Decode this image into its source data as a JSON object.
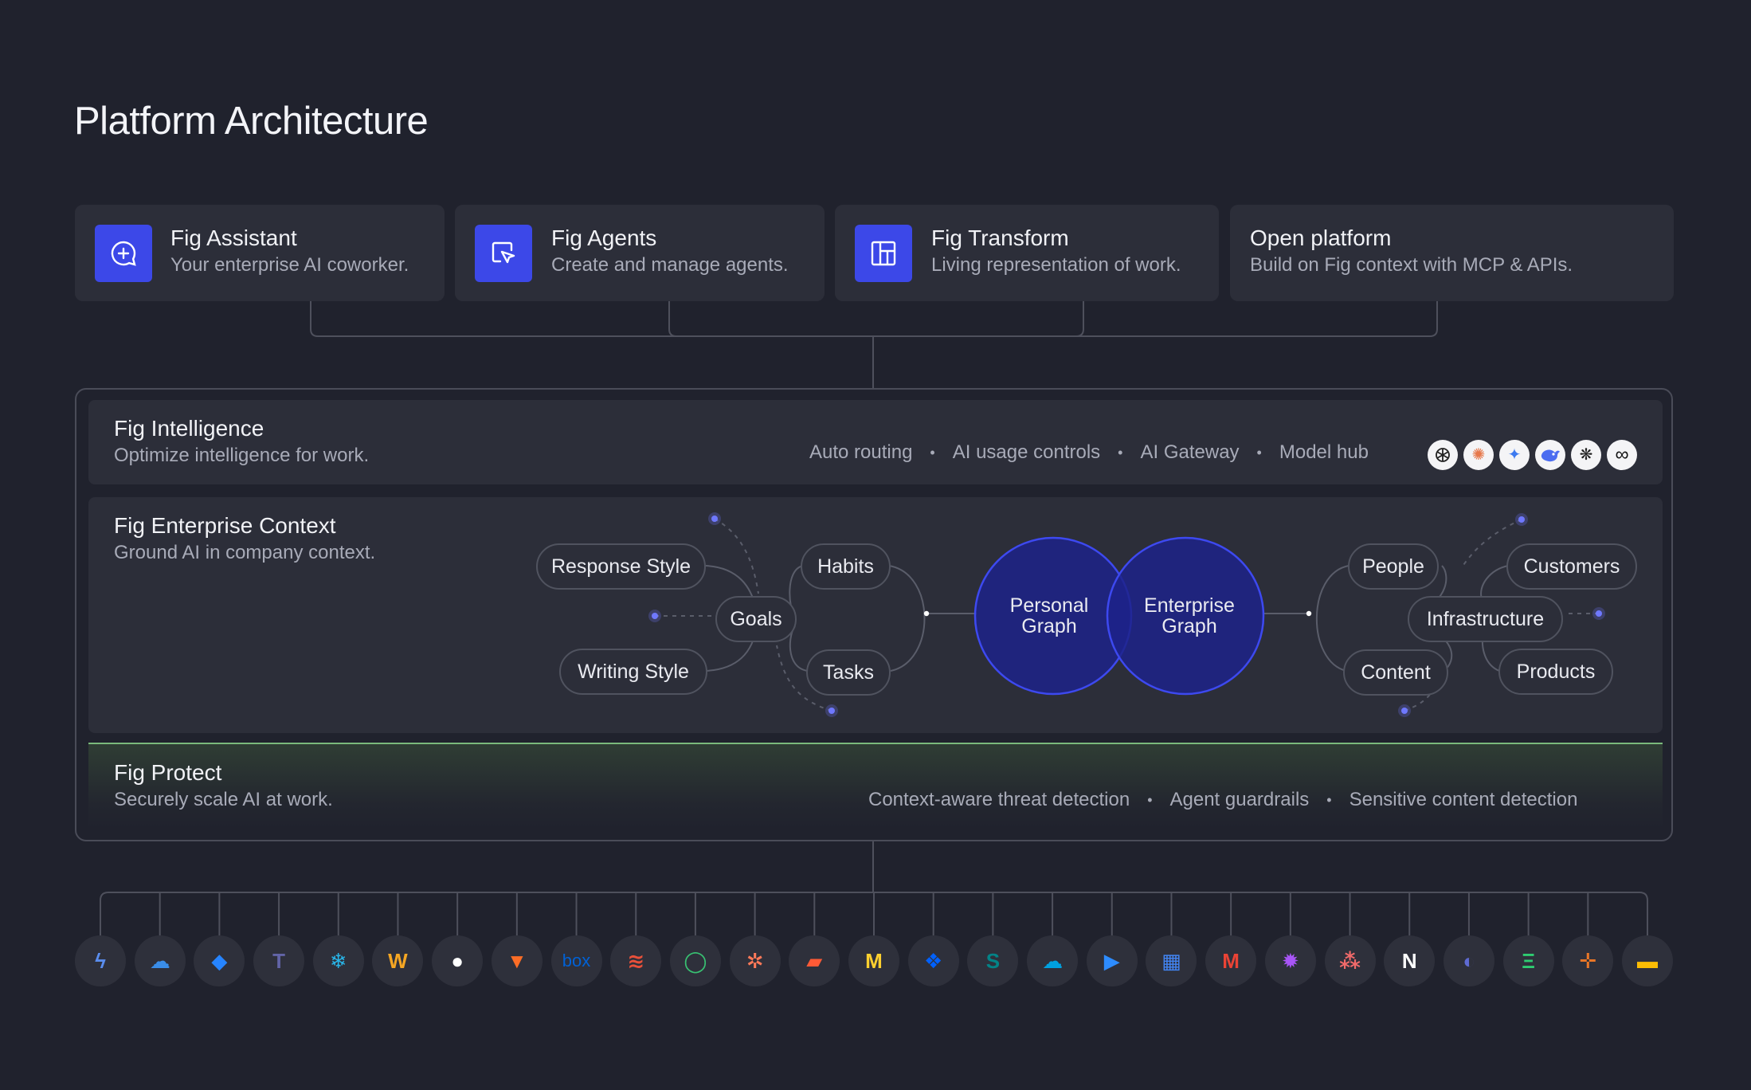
{
  "title": "Platform Architecture",
  "products": [
    {
      "name": "Fig Assistant",
      "desc": "Your enterprise AI coworker.",
      "icon": "chat-plus-icon"
    },
    {
      "name": "Fig Agents",
      "desc": "Create and manage agents.",
      "icon": "cursor-pointer-icon"
    },
    {
      "name": "Fig Transform",
      "desc": "Living representation of work.",
      "icon": "layout-grid-icon"
    },
    {
      "name": "Open platform",
      "desc": "Build on Fig context with MCP & APIs."
    }
  ],
  "intelligence": {
    "title": "Fig Intelligence",
    "subtitle": "Optimize intelligence for work.",
    "features": [
      "Auto routing",
      "AI usage controls",
      "AI Gateway",
      "Model hub"
    ],
    "model_icons": [
      "openai-icon",
      "anthropic-icon",
      "gemini-icon",
      "deepseek-icon",
      "perplexity-icon",
      "meta-icon"
    ]
  },
  "context": {
    "title": "Fig Enterprise Context",
    "subtitle": "Ground AI in company context.",
    "personal_nodes": [
      "Response Style",
      "Habits",
      "Goals",
      "Writing Style",
      "Tasks"
    ],
    "graphs": [
      "Personal Graph",
      "Enterprise Graph"
    ],
    "enterprise_nodes": [
      "People",
      "Customers",
      "Infrastructure",
      "Content",
      "Products"
    ]
  },
  "protect": {
    "title": "Fig Protect",
    "subtitle": "Securely scale AI at work.",
    "features": [
      "Context-aware threat detection",
      "Agent guardrails",
      "Sensitive content detection"
    ]
  },
  "colors": {
    "background": "#20222d",
    "panel": "#2c2e39",
    "accent": "#3c48e8",
    "graph_fill": "#1d2289",
    "protect_line": "#7ab97c"
  },
  "connectors": [
    {
      "icon": "zapier-lightning-icon",
      "color": "#5a8dee"
    },
    {
      "icon": "onedrive-icon",
      "color": "#3a8de8"
    },
    {
      "icon": "jira-icon",
      "color": "#2684ff"
    },
    {
      "icon": "teams-icon",
      "color": "#6264a7"
    },
    {
      "icon": "snowflake-icon",
      "color": "#29b5e8"
    },
    {
      "icon": "workday-icon",
      "color": "#f5a623"
    },
    {
      "icon": "github-icon",
      "color": "#ffffff"
    },
    {
      "icon": "gitlab-icon",
      "color": "#fc6d26"
    },
    {
      "icon": "box-icon",
      "color": "#0061d5",
      "label": "box"
    },
    {
      "icon": "stack-icon",
      "color": "#e8503a"
    },
    {
      "icon": "ring-icon",
      "color": "#38c172"
    },
    {
      "icon": "hubspot-icon",
      "color": "#ff7a59"
    },
    {
      "icon": "figma-slides-icon",
      "color": "#ff5a36"
    },
    {
      "icon": "miro-icon",
      "color": "#ffd02f"
    },
    {
      "icon": "dropbox-icon",
      "color": "#0061fe"
    },
    {
      "icon": "sharepoint-icon",
      "color": "#038387"
    },
    {
      "icon": "salesforce-icon",
      "color": "#00a1e0"
    },
    {
      "icon": "zoom-icon",
      "color": "#2d8cff"
    },
    {
      "icon": "calendar-icon",
      "color": "#4285f4"
    },
    {
      "icon": "gmail-icon",
      "color": "#ea4335"
    },
    {
      "icon": "burst-icon",
      "color": "#a855f7"
    },
    {
      "icon": "asana-icon",
      "color": "#f06a6a"
    },
    {
      "icon": "notion-icon",
      "color": "#ffffff"
    },
    {
      "icon": "linear-icon",
      "color": "#5e6ad2"
    },
    {
      "icon": "confluence-icon",
      "color": "#2ecc71"
    },
    {
      "icon": "tableau-icon",
      "color": "#e97627"
    },
    {
      "icon": "google-slides-icon",
      "color": "#fbbc04"
    }
  ]
}
